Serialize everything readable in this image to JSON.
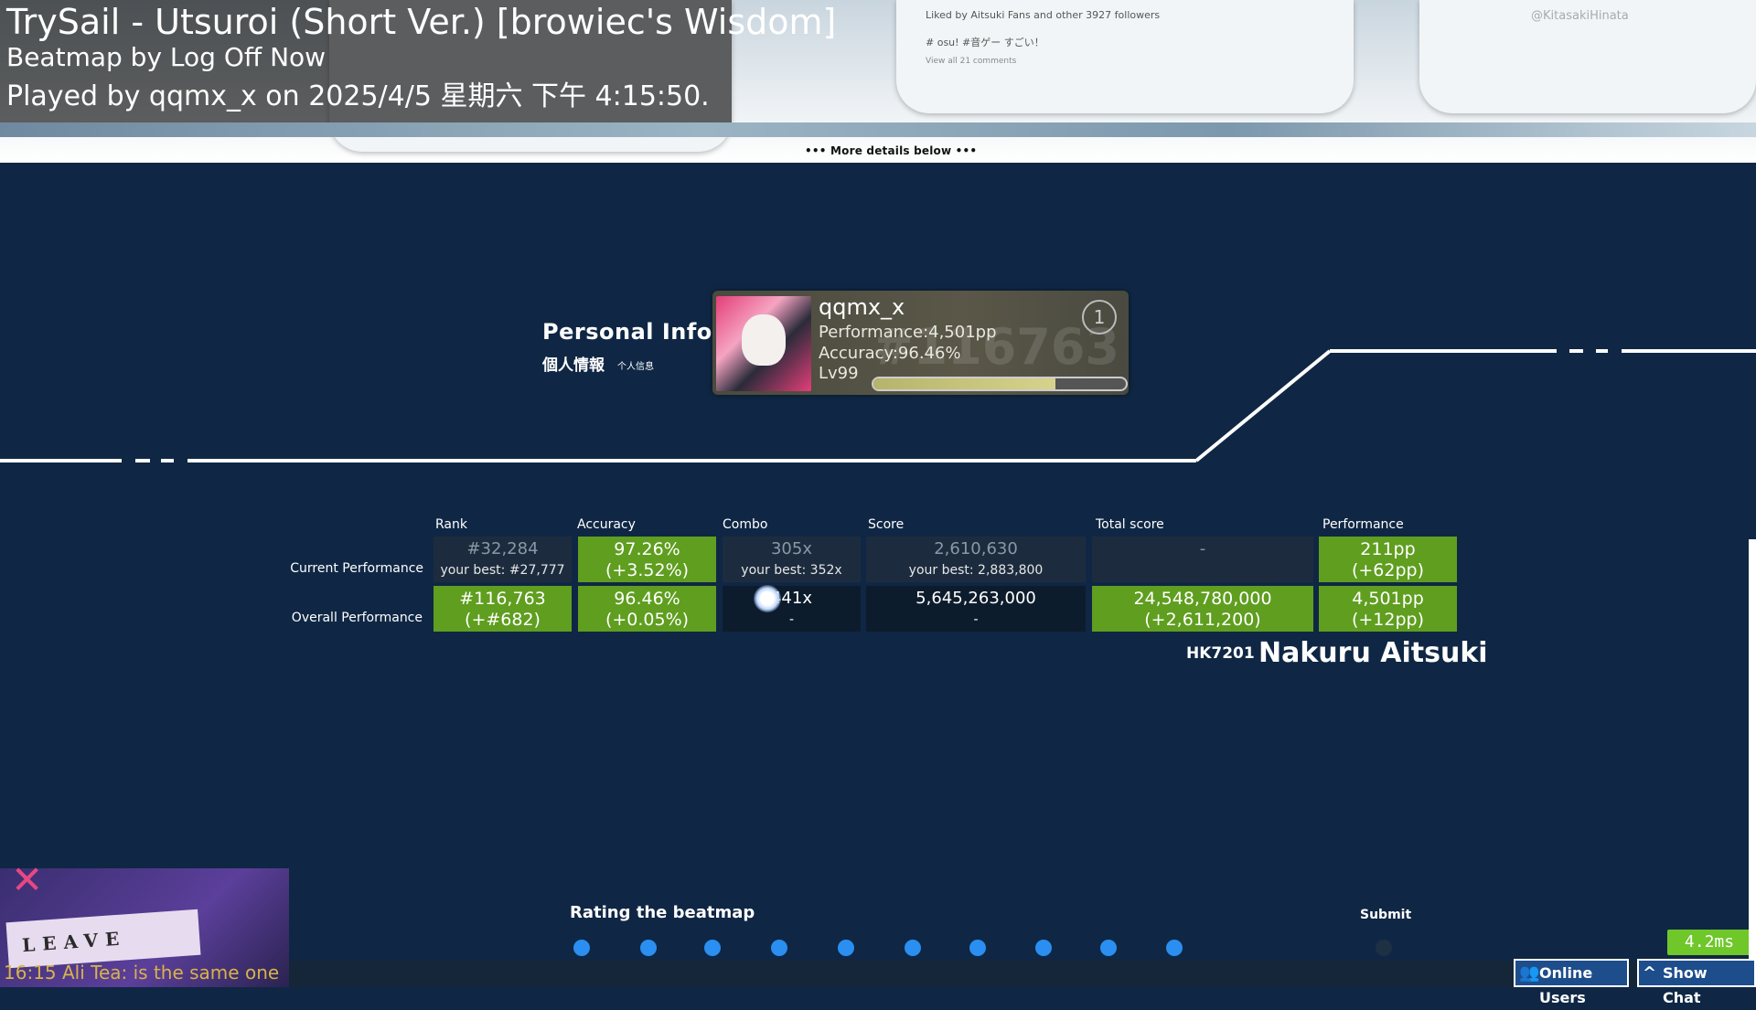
{
  "header": {
    "title": "TrySail - Utsuroi (Short Ver.) [browiec's Wisdom]",
    "mapper": "Beatmap by Log Off Now",
    "played_by": "Played by qqmx_x on 2025/4/5 星期六 下午 4:15:50."
  },
  "banner": {
    "more_details": "••• More details below •••",
    "social_likes": "Liked by Aitsuki Fans and other 3927 followers",
    "social_tags": "# osu! #音ゲー すごい！",
    "social_comments": "View all 21 comments",
    "handle": "@KitasakiHinata"
  },
  "personal_info": {
    "title": "Personal Info.",
    "subtitle": "個人情報",
    "subtitle_small": "个人信息"
  },
  "player_card": {
    "name": "qqmx_x",
    "performance": "Performance:4,501pp",
    "accuracy": "Accuracy:96.46%",
    "level": "Lv99",
    "rank_watermark": "#116763",
    "level_progress": 0.72
  },
  "table": {
    "columns": [
      "Rank",
      "Accuracy",
      "Combo",
      "Score",
      "Total score",
      "Performance"
    ],
    "rows": [
      {
        "label": "Current Performance",
        "rank": [
          "#32,284",
          "your best: #27,777"
        ],
        "accuracy": [
          "97.26%",
          "(+3.52%)"
        ],
        "combo": [
          "305x",
          "your best: 352x"
        ],
        "score": [
          "2,610,630",
          "your best: 2,883,800"
        ],
        "total": [
          "-",
          ""
        ],
        "performance": [
          "211pp",
          "(+62pp)"
        ]
      },
      {
        "label": "Overall Performance",
        "rank": [
          "#116,763",
          "(+#682)"
        ],
        "accuracy": [
          "96.46%",
          "(+0.05%)"
        ],
        "combo": [
          "441x",
          "-"
        ],
        "score": [
          "5,645,263,000",
          "-"
        ],
        "total": [
          "24,548,780,000",
          "(+2,611,200)"
        ],
        "performance": [
          "4,501pp",
          "(+12pp)"
        ]
      }
    ]
  },
  "station": {
    "code": "HK7201",
    "name": "Nakuru Aitsuki"
  },
  "rating": {
    "label": "Rating the beatmap",
    "count": 10,
    "submit": "Submit"
  },
  "chat": {
    "image_text": "LEAVE",
    "line": "16:15 Ali Tea: is the same one"
  },
  "status": {
    "latency": "4.2ms",
    "online_users": "Online Users",
    "show_chat": "Show Chat"
  },
  "colors": {
    "background": "#0f2744",
    "green_cell": "#5f9e1f",
    "gray_cell": "#1c2c3e",
    "dot": "#2a8ff0"
  }
}
